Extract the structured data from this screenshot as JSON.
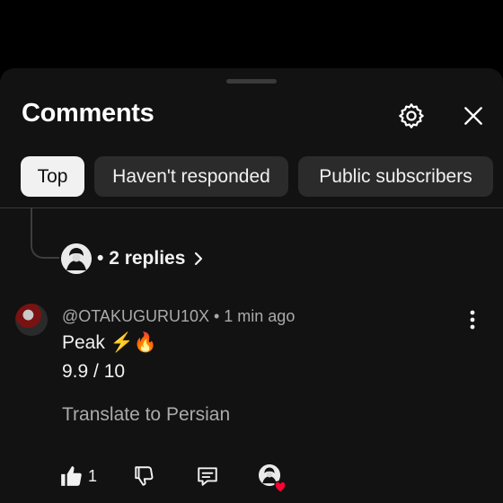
{
  "header": {
    "title": "Comments"
  },
  "icons": {
    "settings": "gear-icon",
    "close": "close-icon",
    "more": "more-vert-icon",
    "like": "thumb-up-icon",
    "dislike": "thumb-down-icon",
    "reply": "comment-icon",
    "creator_heart": "heart-icon"
  },
  "filters": [
    {
      "label": "Top",
      "active": true
    },
    {
      "label": "Haven't responded",
      "active": false
    },
    {
      "label": "Public subscribers",
      "active": false
    }
  ],
  "thread": {
    "replies_label": "2 replies"
  },
  "comment": {
    "author": "@OTAKUGURU10X",
    "time": "1 min ago",
    "text_line1": "Peak ⚡🔥",
    "text_line2": "9.9 / 10",
    "translate_label": "Translate to Persian",
    "like_count": "1"
  },
  "colors": {
    "background": "#000000",
    "sheet": "#121212",
    "chip": "#2b2b2b",
    "chip_active": "#f1f1f1",
    "secondary_text": "#aaaaaa",
    "heart": "#ff0033"
  }
}
